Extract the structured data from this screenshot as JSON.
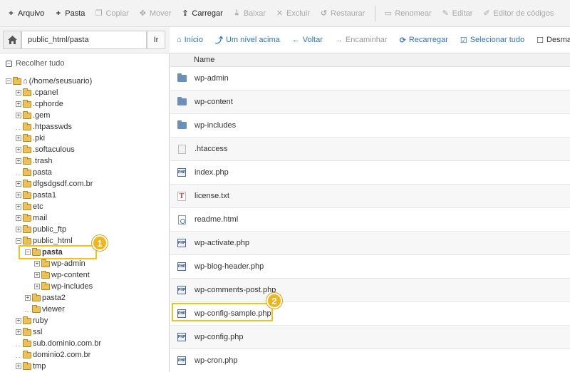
{
  "toolbar": {
    "arquivo": "Arquivo",
    "pasta": "Pasta",
    "copiar": "Copiar",
    "mover": "Mover",
    "carregar": "Carregar",
    "baixar": "Baixar",
    "excluir": "Excluir",
    "restaurar": "Restaurar",
    "renomear": "Renomear",
    "editar": "Editar",
    "editor_codigos": "Editor de códigos"
  },
  "pathbar": {
    "path_value": "public_html/pasta",
    "go_label": "Ir"
  },
  "navbar": {
    "inicio": "Início",
    "nivel_acima": "Um nível acima",
    "voltar": "Voltar",
    "encaminhar": "Encaminhar",
    "recarregar": "Recarregar",
    "selecionar_tudo": "Selecionar tudo",
    "desmarcar": "Desmarcar"
  },
  "sidebar": {
    "collapse_label": "Recolher tudo",
    "tree": [
      {
        "label": "(/home/seusuario)"
      },
      {
        "label": ".cpanel"
      },
      {
        "label": ".cphorde"
      },
      {
        "label": ".gem"
      },
      {
        "label": ".htpasswds"
      },
      {
        "label": ".pki"
      },
      {
        "label": ".softaculous"
      },
      {
        "label": ".trash"
      },
      {
        "label": "pasta"
      },
      {
        "label": "dfgsdgsdf.com.br"
      },
      {
        "label": "pasta1"
      },
      {
        "label": "etc"
      },
      {
        "label": "mail"
      },
      {
        "label": "public_ftp"
      },
      {
        "label": "public_html"
      },
      {
        "label": "pasta"
      },
      {
        "label": "wp-admin"
      },
      {
        "label": "wp-content"
      },
      {
        "label": "wp-includes"
      },
      {
        "label": "pasta2"
      },
      {
        "label": "viewer"
      },
      {
        "label": "ruby"
      },
      {
        "label": "ssl"
      },
      {
        "label": "sub.dominio.com.br"
      },
      {
        "label": "dominio2.com.br"
      },
      {
        "label": "tmp"
      }
    ]
  },
  "filelist": {
    "column_name": "Name",
    "files": [
      {
        "name": "wp-admin",
        "icon": "folder-icon"
      },
      {
        "name": "wp-content",
        "icon": "folder-icon"
      },
      {
        "name": "wp-includes",
        "icon": "folder-icon"
      },
      {
        "name": ".htaccess",
        "icon": "document-icon"
      },
      {
        "name": "index.php",
        "icon": "php-file-icon"
      },
      {
        "name": "license.txt",
        "icon": "text-file-icon"
      },
      {
        "name": "readme.html",
        "icon": "html-file-icon"
      },
      {
        "name": "wp-activate.php",
        "icon": "php-file-icon"
      },
      {
        "name": "wp-blog-header.php",
        "icon": "php-file-icon"
      },
      {
        "name": "wp-comments-post.php",
        "icon": "php-file-icon"
      },
      {
        "name": "wp-config-sample.php",
        "icon": "php-file-icon"
      },
      {
        "name": "wp-config.php",
        "icon": "php-file-icon"
      },
      {
        "name": "wp-cron.php",
        "icon": "php-file-icon"
      }
    ]
  },
  "callouts": {
    "one": "1",
    "two": "2"
  },
  "colors": {
    "link": "#2b74c7",
    "highlight": "#f0c21b",
    "badge": "#f0b41e"
  }
}
